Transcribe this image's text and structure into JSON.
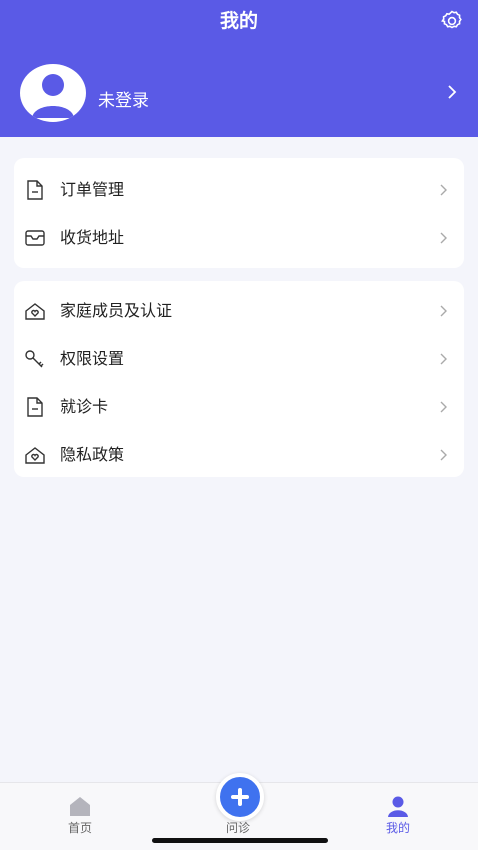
{
  "header": {
    "title": "我的",
    "login_text": "未登录",
    "settings_icon": "gear-icon",
    "accent_color": "#5a5ae6"
  },
  "card1": {
    "items": [
      {
        "label": "订单管理",
        "icon": "document-icon"
      },
      {
        "label": "收货地址",
        "icon": "inbox-icon"
      }
    ]
  },
  "card2": {
    "items": [
      {
        "label": "家庭成员及认证",
        "icon": "house-heart-icon"
      },
      {
        "label": "权限设置",
        "icon": "key-icon"
      },
      {
        "label": "就诊卡",
        "icon": "document-icon"
      },
      {
        "label": "隐私政策",
        "icon": "house-heart-icon"
      }
    ]
  },
  "tabbar": {
    "home": "首页",
    "consult": "问诊",
    "mine": "我的"
  }
}
